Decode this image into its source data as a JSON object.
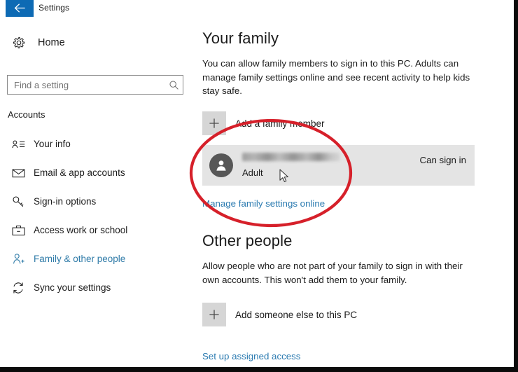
{
  "window": {
    "title": "Settings",
    "back_icon": "back-arrow-icon",
    "accent_color": "#0d6ab4"
  },
  "sidebar": {
    "home": {
      "label": "Home",
      "icon": "gear-icon"
    },
    "search": {
      "placeholder": "Find a setting",
      "value": "",
      "icon": "search-icon"
    },
    "group_title": "Accounts",
    "items": [
      {
        "label": "Your info",
        "icon": "contact-card-icon",
        "selected": false
      },
      {
        "label": "Email & app accounts",
        "icon": "envelope-icon",
        "selected": false
      },
      {
        "label": "Sign-in options",
        "icon": "key-icon",
        "selected": false
      },
      {
        "label": "Access work or school",
        "icon": "briefcase-icon",
        "selected": false
      },
      {
        "label": "Family & other people",
        "icon": "person-add-icon",
        "selected": true
      },
      {
        "label": "Sync your settings",
        "icon": "sync-icon",
        "selected": false
      }
    ],
    "selected_color": "#2f7ba8"
  },
  "main": {
    "family": {
      "heading": "Your family",
      "description": "You can allow family members to sign in to this PC. Adults can manage family settings online and see recent activity to help kids stay safe.",
      "add_member": {
        "label": "Add a family member",
        "icon": "plus-icon"
      },
      "member": {
        "email": "",
        "email_redacted": true,
        "role": "Adult",
        "status": "Can sign in",
        "avatar_icon": "person-icon"
      },
      "manage_link": "Manage family settings online"
    },
    "other_people": {
      "heading": "Other people",
      "description": "Allow people who are not part of your family to sign in with their own accounts. This won't add them to your family.",
      "add_someone": {
        "label": "Add someone else to this PC",
        "icon": "plus-icon"
      },
      "assigned_access_link": "Set up assigned access"
    }
  },
  "annotation": {
    "shape": "ellipse",
    "color": "#d6202a",
    "targets": "family member row"
  },
  "cursor": {
    "icon": "mouse-pointer-icon"
  }
}
